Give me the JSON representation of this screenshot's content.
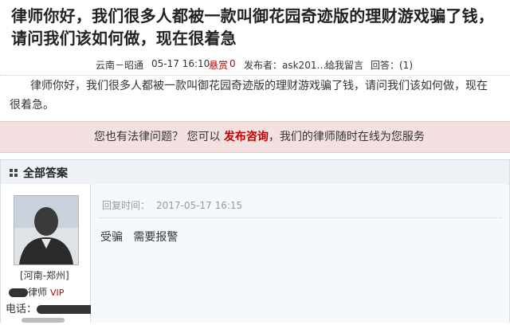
{
  "question": {
    "title": "律师你好，我们很多人都被一款叫御花园奇迹版的理财游戏骗了钱，请问我们该如何做，现在很着急",
    "location": "云南－昭通",
    "date": "05-17 16:10",
    "reward_label": "悬赏",
    "reward_value": "0",
    "publisher": "发布者：ask201……",
    "reply_link": "给我留言",
    "answers_count": "回答：(1)",
    "body": "律师你好，我们很多人都被一款叫御花园奇迹版的理财游戏骗了钱，请问我们该如何做，现在很着急。"
  },
  "banner": {
    "prefix": "您也有法律问题？ 您可以",
    "highlight": "发布咨询",
    "suffix": "，我们的律师随时在线为您服务"
  },
  "answers_section": {
    "title": "全部答案"
  },
  "answer": {
    "lawyer": {
      "region": "[河南-郑州]",
      "title": "律师",
      "vip": "VIP",
      "phone_label": "电话："
    },
    "reply_time_label": "回复时间：",
    "reply_time": "2017-05-17 16:15",
    "reply_text": "受骗   需要报警"
  },
  "icons": {
    "answers_header": "grid-icon",
    "avatar": "lawyer-avatar-photo"
  },
  "colors": {
    "accent_red": "#c00000",
    "banner_bg": "#f3e0e0",
    "header_bg": "#eef2f6",
    "reply_bg": "#f5f9fc"
  }
}
